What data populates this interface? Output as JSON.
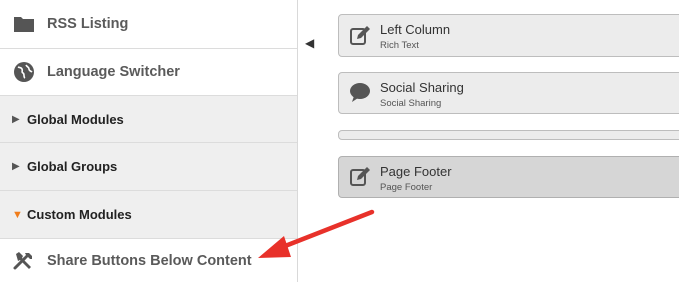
{
  "sidebar": {
    "items": [
      {
        "type": "module",
        "label": "RSS Listing",
        "icon": "folder-icon"
      },
      {
        "type": "module",
        "label": "Language Switcher",
        "icon": "globe-icon"
      },
      {
        "type": "group",
        "label": "Global Modules",
        "state": "collapsed"
      },
      {
        "type": "group",
        "label": "Global Groups",
        "state": "collapsed"
      },
      {
        "type": "group",
        "label": "Custom Modules",
        "state": "expanded"
      },
      {
        "type": "module",
        "label": "Share Buttons Below Content",
        "icon": "tools-icon"
      }
    ]
  },
  "canvas": {
    "collapse_glyph": "◀",
    "cards": [
      {
        "title": "Left Column",
        "subtitle": "Rich Text",
        "icon": "edit-icon"
      },
      {
        "title": "Social Sharing",
        "subtitle": "Social Sharing",
        "icon": "speech-bubble-icon"
      },
      {
        "title": "",
        "subtitle": ""
      },
      {
        "title": "Page Footer",
        "subtitle": "Page Footer",
        "icon": "edit-icon"
      }
    ]
  },
  "triangles": {
    "collapsed": "▶",
    "expanded": "▼"
  },
  "colors": {
    "accent": "#f07d1b",
    "annotation_arrow": "#e8312a",
    "group_bg": "#efefef",
    "card_bg": "#ececec"
  }
}
